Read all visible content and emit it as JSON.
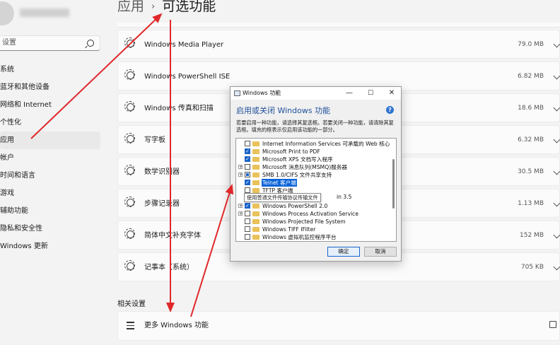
{
  "sidebar": {
    "search_placeholder": "设置",
    "items": [
      {
        "label": "系统"
      },
      {
        "label": "蓝牙和其他设备"
      },
      {
        "label": "网络和 Internet"
      },
      {
        "label": "个性化"
      },
      {
        "label": "应用",
        "active": true
      },
      {
        "label": "帐户"
      },
      {
        "label": "时间和语言"
      },
      {
        "label": "游戏"
      },
      {
        "label": "辅助功能"
      },
      {
        "label": "隐私和安全性"
      },
      {
        "label": "Windows 更新"
      }
    ]
  },
  "breadcrumb": {
    "parent": "应用",
    "separator": "›",
    "current": "可选功能"
  },
  "features": [
    {
      "name": "Windows Media Player",
      "size": "79.0 MB"
    },
    {
      "name": "Windows PowerShell ISE",
      "size": "6.82 MB"
    },
    {
      "name": "Windows 传真和扫描",
      "size": "18.6 MB"
    },
    {
      "name": "写字板",
      "size": "6.32 MB"
    },
    {
      "name": "数学识别器",
      "size": "30.5 MB"
    },
    {
      "name": "步骤记录器",
      "size": "1.13 MB"
    },
    {
      "name": "简体中文补充字体",
      "size": "152 MB"
    },
    {
      "name": "记事本（系统）",
      "size": "705 KB"
    }
  ],
  "related": {
    "title": "相关设置",
    "more_label": "更多 Windows 功能"
  },
  "dialog": {
    "title": "Windows 功能",
    "minimize": "—",
    "maximize": "☐",
    "close": "✕",
    "heading": "启用或关闭 Windows 功能",
    "help": "?",
    "description": "若要启用一种功能，请选择其复选框。若要关闭一种功能，请清除其复选框。填充的框表示仅启用该功能的一部分。",
    "tree": [
      {
        "label": "Internet Information Services 可承载的 Web 核心",
        "check": "none",
        "expand": false
      },
      {
        "label": "Microsoft Print to PDF",
        "check": "checked",
        "expand": false
      },
      {
        "label": "Microsoft XPS 文档写入程序",
        "check": "checked",
        "expand": false
      },
      {
        "label": "Microsoft 消息队列(MSMQ)服务器",
        "check": "none",
        "expand": true
      },
      {
        "label": "SMB 1.0/CIFS 文件共享支持",
        "check": "partial",
        "expand": true
      },
      {
        "label": "Telnet 客户端",
        "check": "checked",
        "expand": false,
        "selected": true
      },
      {
        "label": "TFTP 客户端",
        "check": "none",
        "expand": false
      },
      {
        "label": "",
        "check": "none",
        "expand": false
      },
      {
        "label": "Windows PowerShell 2.0",
        "check": "checked",
        "expand": true
      },
      {
        "label": "Windows Process Activation Service",
        "check": "none",
        "expand": true
      },
      {
        "label": "Windows Projected File System",
        "check": "none",
        "expand": false
      },
      {
        "label": "Windows TIFF IFilter",
        "check": "none",
        "expand": false
      },
      {
        "label": "Windows 虚拟机监控程序平台",
        "check": "none",
        "expand": false
      }
    ],
    "tooltip": "使用普通文件传输协议传输文件",
    "tooltip_tail": "in 3.5",
    "ok": "确定",
    "cancel": "取消"
  },
  "colors": {
    "accent": "#1a63c9",
    "annotation_arrow": "#e0282a",
    "background": "#f3f3f3",
    "card": "#fbfbfb"
  }
}
